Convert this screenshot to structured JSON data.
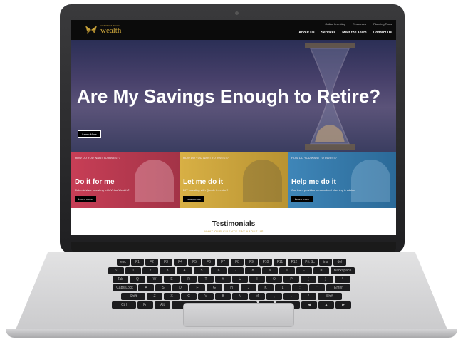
{
  "header": {
    "logo_top": "ATTAWWA NOVA",
    "logo_word": "wealth",
    "top_links": [
      "Online Investing",
      "Resources",
      "Planning Tools"
    ],
    "main_nav": [
      "About Us",
      "Services",
      "Meet the Team",
      "Contact Us"
    ]
  },
  "hero": {
    "title": "Are My Savings Enough to Retire?",
    "button": "Learn More"
  },
  "panels": [
    {
      "eyebrow": "HOW DO YOU WANT TO INVEST?",
      "title": "Do it for me",
      "desc": "Robo Advisor investing with VirtualWealth®.",
      "button": "Learn more"
    },
    {
      "eyebrow": "HOW DO YOU WANT TO INVEST?",
      "title": "Let me do it",
      "desc": "DIY investing with Qtrade Investor®",
      "button": "Learn more"
    },
    {
      "eyebrow": "HOW DO YOU WANT TO INVEST?",
      "title": "Help me do it",
      "desc": "Our team provides personalized planning & advice",
      "button": "Learn more"
    }
  ],
  "testimonials": {
    "title": "Testimonials",
    "subtitle": "WHAT OUR CLIENTS SAY ABOUT US"
  },
  "keyboard": {
    "rows": [
      [
        "esc",
        "F1",
        "F2",
        "F3",
        "F4",
        "F5",
        "F6",
        "F7",
        "F8",
        "F9",
        "F10",
        "F11",
        "F12",
        "Prt Sc",
        "ins",
        "del"
      ],
      [
        "~",
        "1",
        "2",
        "3",
        "4",
        "5",
        "6",
        "7",
        "8",
        "9",
        "0",
        "-",
        "=",
        "Backspace"
      ],
      [
        "Tab",
        "Q",
        "W",
        "E",
        "R",
        "T",
        "Y",
        "U",
        "I",
        "O",
        "P",
        "[",
        "]",
        "\\"
      ],
      [
        "Caps Lock",
        "A",
        "S",
        "D",
        "F",
        "G",
        "H",
        "J",
        "K",
        "L",
        ";",
        "'",
        "Enter"
      ],
      [
        "Shift",
        "Z",
        "X",
        "C",
        "V",
        "B",
        "N",
        "M",
        ",",
        ".",
        "/",
        "Shift"
      ],
      [
        "Ctrl",
        "Fn",
        "Alt",
        "",
        "Alt",
        "Ctrl",
        "◀",
        "▲",
        "▶"
      ]
    ]
  },
  "colors": {
    "gold": "#c8a23a",
    "panel_red": "#c73e56",
    "panel_yellow": "#d8b045",
    "panel_blue": "#3f86b8"
  }
}
